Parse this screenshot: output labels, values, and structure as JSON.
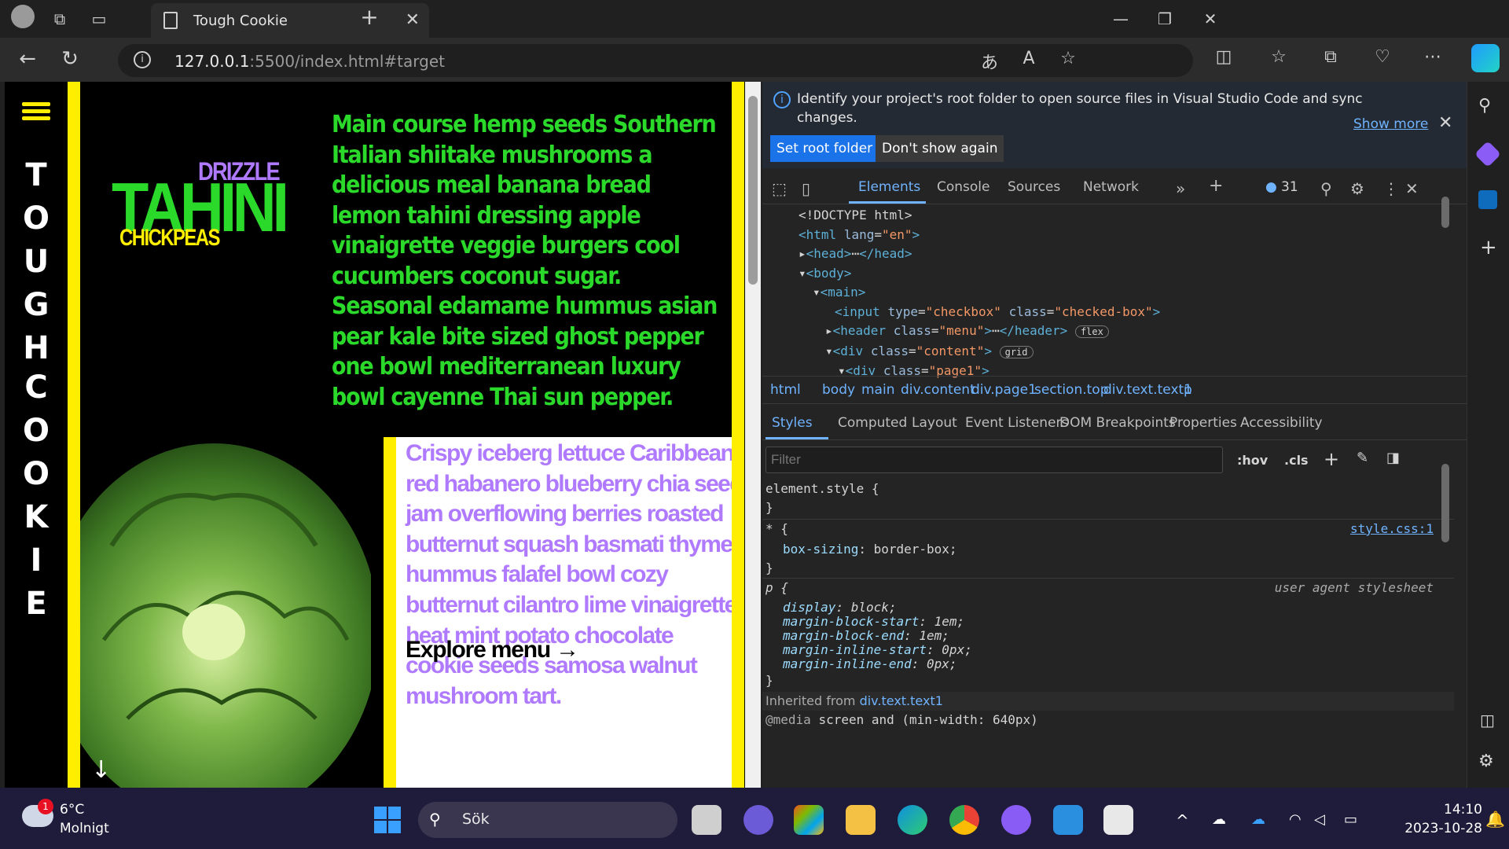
{
  "browser": {
    "tab_title": "Tough Cookie",
    "url_host": "127.0.0.1",
    "url_rest": ":5500/index.html#target"
  },
  "page": {
    "vertical_title_top": [
      "T",
      "O",
      "U",
      "G",
      "H"
    ],
    "vertical_title_bottom": [
      "C",
      "O",
      "O",
      "K",
      "I",
      "E"
    ],
    "logo": {
      "drizzle": "DRIZZLE",
      "tahini": "TAHINI",
      "chickpeas": "CHICKPEAS"
    },
    "main_text": "Main course hemp seeds Southern Italian shiitake mushrooms a delicious meal banana bread lemon tahini dressing apple vinaigrette veggie burgers cool cucumbers coconut sugar. Seasonal edamame hummus asian pear kale bite sized ghost pepper one bowl mediterranean luxury bowl cayenne Thai sun pepper.",
    "purple_text": "Crispy iceberg lettuce Caribbean red habanero blueberry chia seed jam overflowing berries roasted butternut squash basmati thyme hummus falafel bowl cozy butternut cilantro lime vinaigrette heat mint potato chocolate cookie seeds samosa walnut mushroom tart.",
    "explore": "Explore menu →",
    "down_arrow": "↓",
    "colors": {
      "yellow": "#ffee00",
      "green": "#2bd92b",
      "purple": "#b07aff"
    }
  },
  "devtools": {
    "banner": {
      "message": "Identify your project's root folder to open source files in Visual Studio Code and sync changes.",
      "set_root": "Set root folder",
      "dont_show": "Don't show again",
      "show_more": "Show more"
    },
    "tabs": [
      "Elements",
      "Console",
      "Sources",
      "Network"
    ],
    "issues_count": "31",
    "dom": {
      "doctype": "<!DOCTYPE html>",
      "html_open": "<html",
      "lang_attr": "lang",
      "lang_val": "\"en\"",
      "head": "<head>",
      "head_close": "</head>",
      "body": "<body>",
      "main": "<main>",
      "input_tag": "<input",
      "input_type": "type",
      "input_type_val": "\"checkbox\"",
      "class_attr": "class",
      "input_class_val": "\"checked-box\"",
      "header_tag": "<header",
      "header_class_val": "\"menu\"",
      "header_close": "</header>",
      "flex_badge": "flex",
      "div_tag": "<div",
      "content_class_val": "\"content\"",
      "grid_badge": "grid",
      "page1_class_val": "\"page1\""
    },
    "breadcrumbs": [
      "html",
      "body",
      "main",
      "div.content",
      "div.page1",
      "section.top",
      "div.text.text1",
      "p"
    ],
    "subtabs": [
      "Styles",
      "Computed",
      "Layout",
      "Event Listeners",
      "DOM Breakpoints",
      "Properties",
      "Accessibility"
    ],
    "filter_placeholder": "Filter",
    "hov": ":hov",
    "cls": ".cls",
    "styles": {
      "element_style": "element.style {",
      "close_brace": "}",
      "star_rule": "* {",
      "star_source": "style.css:1",
      "box_sizing_prop": "box-sizing",
      "box_sizing_val": "border-box;",
      "p_rule": "p {",
      "ua": "user agent stylesheet",
      "ua_props": [
        {
          "p": "display",
          "v": "block;"
        },
        {
          "p": "margin-block-start",
          "v": "1em;"
        },
        {
          "p": "margin-block-end",
          "v": "1em;"
        },
        {
          "p": "margin-inline-start",
          "v": "0px;"
        },
        {
          "p": "margin-inline-end",
          "v": "0px;"
        }
      ],
      "inherited_label": "Inherited from",
      "inherited_from": "div.text.text1",
      "media": "@media",
      "media_query": "screen and (min-width: 640px)"
    }
  },
  "taskbar": {
    "weather_temp": "6°C",
    "weather_desc": "Molnigt",
    "weather_badge": "1",
    "search_label": "Sök",
    "time": "14:10",
    "date": "2023-10-28"
  }
}
